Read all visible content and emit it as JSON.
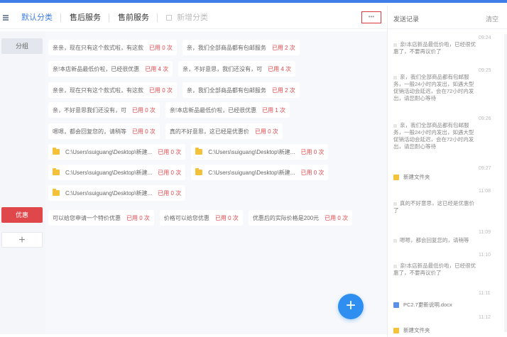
{
  "tabs": {
    "items": [
      {
        "label": "默认分类",
        "active": true
      },
      {
        "label": "售后服务",
        "active": false
      },
      {
        "label": "售前服务",
        "active": false
      },
      {
        "label": "新增分类",
        "active": false
      }
    ],
    "more_label": "•••"
  },
  "categories": {
    "first": "分组",
    "second": "优惠",
    "add": "+"
  },
  "phrases": {
    "row1": [
      {
        "text": "亲亲，现在只有这个款式啦，有这款",
        "used": "已用 0 次"
      },
      {
        "text": "亲，我们全部商品都有包邮服务",
        "used": "已用 2 次"
      }
    ],
    "row2": [
      {
        "text": "亲!本店新品最低价啦，已经很优惠",
        "used": "已用 4 次"
      },
      {
        "text": "亲，不好意思，我们还没有，可",
        "used": "已用 4 次"
      }
    ],
    "row3": [
      {
        "text": "亲亲，现在只有这个款式啦，有这款",
        "used": "已用 0 次"
      },
      {
        "text": "亲，我们全部商品都有包邮服务",
        "used": "已用 2 次"
      }
    ],
    "row4": [
      {
        "text": "亲，不好意思我们还没有，可",
        "used": "已用 0 次"
      },
      {
        "text": "亲!本店新品最低价啦，已经很优惠",
        "used": "已用 1 次"
      }
    ],
    "row5": [
      {
        "text": "嗯嗯，都会回复您的，请稍等",
        "used": "已用 0 次"
      },
      {
        "text": "真的不好意思，这已经是优惠价",
        "used": "已用 0 次"
      }
    ],
    "files": [
      {
        "text": "C:\\Users\\suiguang\\Desktop\\新建...",
        "used": "已用 0 次"
      },
      {
        "text": "C:\\Users\\suiguang\\Desktop\\新建...",
        "used": "已用 0 次"
      },
      {
        "text": "C:\\Users\\suiguang\\Desktop\\新建...",
        "used": "已用 0 次"
      },
      {
        "text": "C:\\Users\\suiguang\\Desktop\\新建...",
        "used": "已用 0 次"
      },
      {
        "text": "C:\\Users\\suiguang\\Desktop\\新建...",
        "used": "已用 0 次"
      }
    ],
    "offers": [
      {
        "text": "可以给您申请一个特价优惠",
        "used": "已用 0 次"
      },
      {
        "text": "价格可以给您优惠",
        "used": "已用 0 次"
      },
      {
        "text": "优惠后的实际价格是200元",
        "used": "已用 0 次"
      }
    ]
  },
  "fab_label": "+",
  "right_panel": {
    "title": "发送记录",
    "edge_label": "清空",
    "timestamps": [
      "09:24",
      "09:25",
      "09:26",
      "09:27",
      "11:08",
      "11:09",
      "11:10",
      "11:11",
      "11:12",
      "11:13"
    ],
    "messages": [
      "亲!本店新品最低价啦，已经很优惠了，不要再议价了",
      "亲，我们全部商品都有包邮服务，一般24小时内发出，如遇大型促销活动会延迟，会在72小时内发出，请您耐心等待",
      "亲，我们全部商品都有包邮服务，一般24小时内发出，如遇大型促销活动会延迟，会在72小时内发出，请您耐心等待",
      "真的不好意思，这已经是优惠价了",
      "嗯嗯，都会回复您的，请稍等",
      "亲!本店新品最低价啦，已经很优惠了，不要再议价了"
    ],
    "files": [
      "新建文件夹",
      "PC2.7更新说明.docx",
      "新建文件夹"
    ]
  }
}
